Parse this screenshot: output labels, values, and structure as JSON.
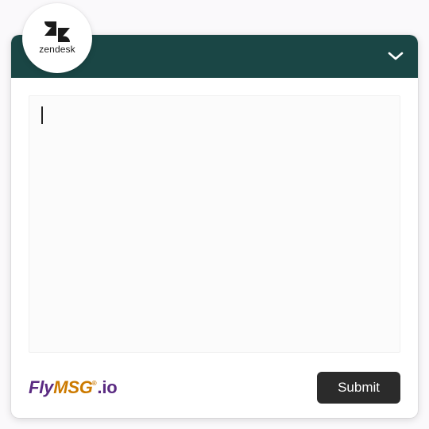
{
  "badge": {
    "brand_label": "zendesk",
    "icon_name": "zendesk-icon"
  },
  "header": {
    "collapse_icon": "chevron-down-icon"
  },
  "message": {
    "value": "",
    "placeholder": ""
  },
  "footer": {
    "brand": {
      "part1": "Fly",
      "part2": "MSG",
      "reg": "®",
      "part3": ".",
      "part4": "io"
    },
    "submit_label": "Submit"
  },
  "colors": {
    "header_bg": "#1a4645",
    "submit_bg": "#2b2b2b",
    "brand_purple": "#5a2a82",
    "brand_orange": "#cc7a00",
    "page_bg": "#faf9fb"
  }
}
